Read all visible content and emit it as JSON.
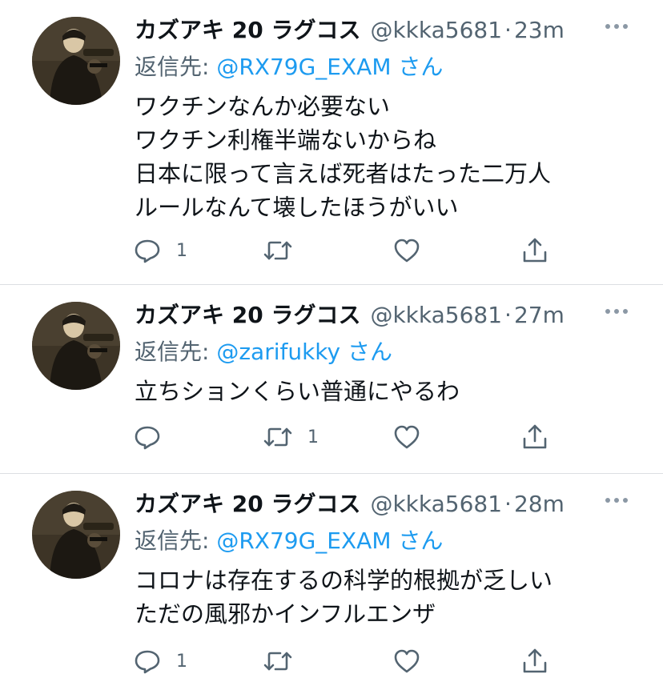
{
  "tweets": [
    {
      "display_name": "カズアキ 20 ラグコス",
      "handle": "@kkka5681",
      "time": "23m",
      "reply_prefix": "返信先:",
      "reply_target": "@RX79G_EXAM",
      "reply_suffix": "さん",
      "lines": [
        "ワクチンなんか必要ない",
        "ワクチン利権半端ないからね",
        "日本に限って言えば死者はたった二万人",
        "ルールなんて壊したほうがいい"
      ],
      "reply_count": "1",
      "retweet_count": "",
      "like_count": ""
    },
    {
      "display_name": "カズアキ 20 ラグコス",
      "handle": "@kkka5681",
      "time": "27m",
      "reply_prefix": "返信先:",
      "reply_target": "@zarifukky",
      "reply_suffix": "さん",
      "lines": [
        "立ちションくらい普通にやるわ"
      ],
      "reply_count": "",
      "retweet_count": "1",
      "like_count": ""
    },
    {
      "display_name": "カズアキ 20 ラグコス",
      "handle": "@kkka5681",
      "time": "28m",
      "reply_prefix": "返信先:",
      "reply_target": "@RX79G_EXAM",
      "reply_suffix": "さん",
      "lines": [
        "コロナは存在するの科学的根拠が乏しい",
        "ただの風邪かインフルエンザ"
      ],
      "reply_count": "1",
      "retweet_count": "",
      "like_count": ""
    }
  ],
  "separator": "·",
  "icons": {
    "reply": "reply-icon",
    "retweet": "retweet-icon",
    "like": "heart-icon",
    "share": "share-icon",
    "more": "more-icon"
  },
  "colors": {
    "link": "#1d9bf0",
    "secondary_text": "#536471",
    "primary_text": "#0f1419",
    "divider": "#dcdfe2"
  }
}
